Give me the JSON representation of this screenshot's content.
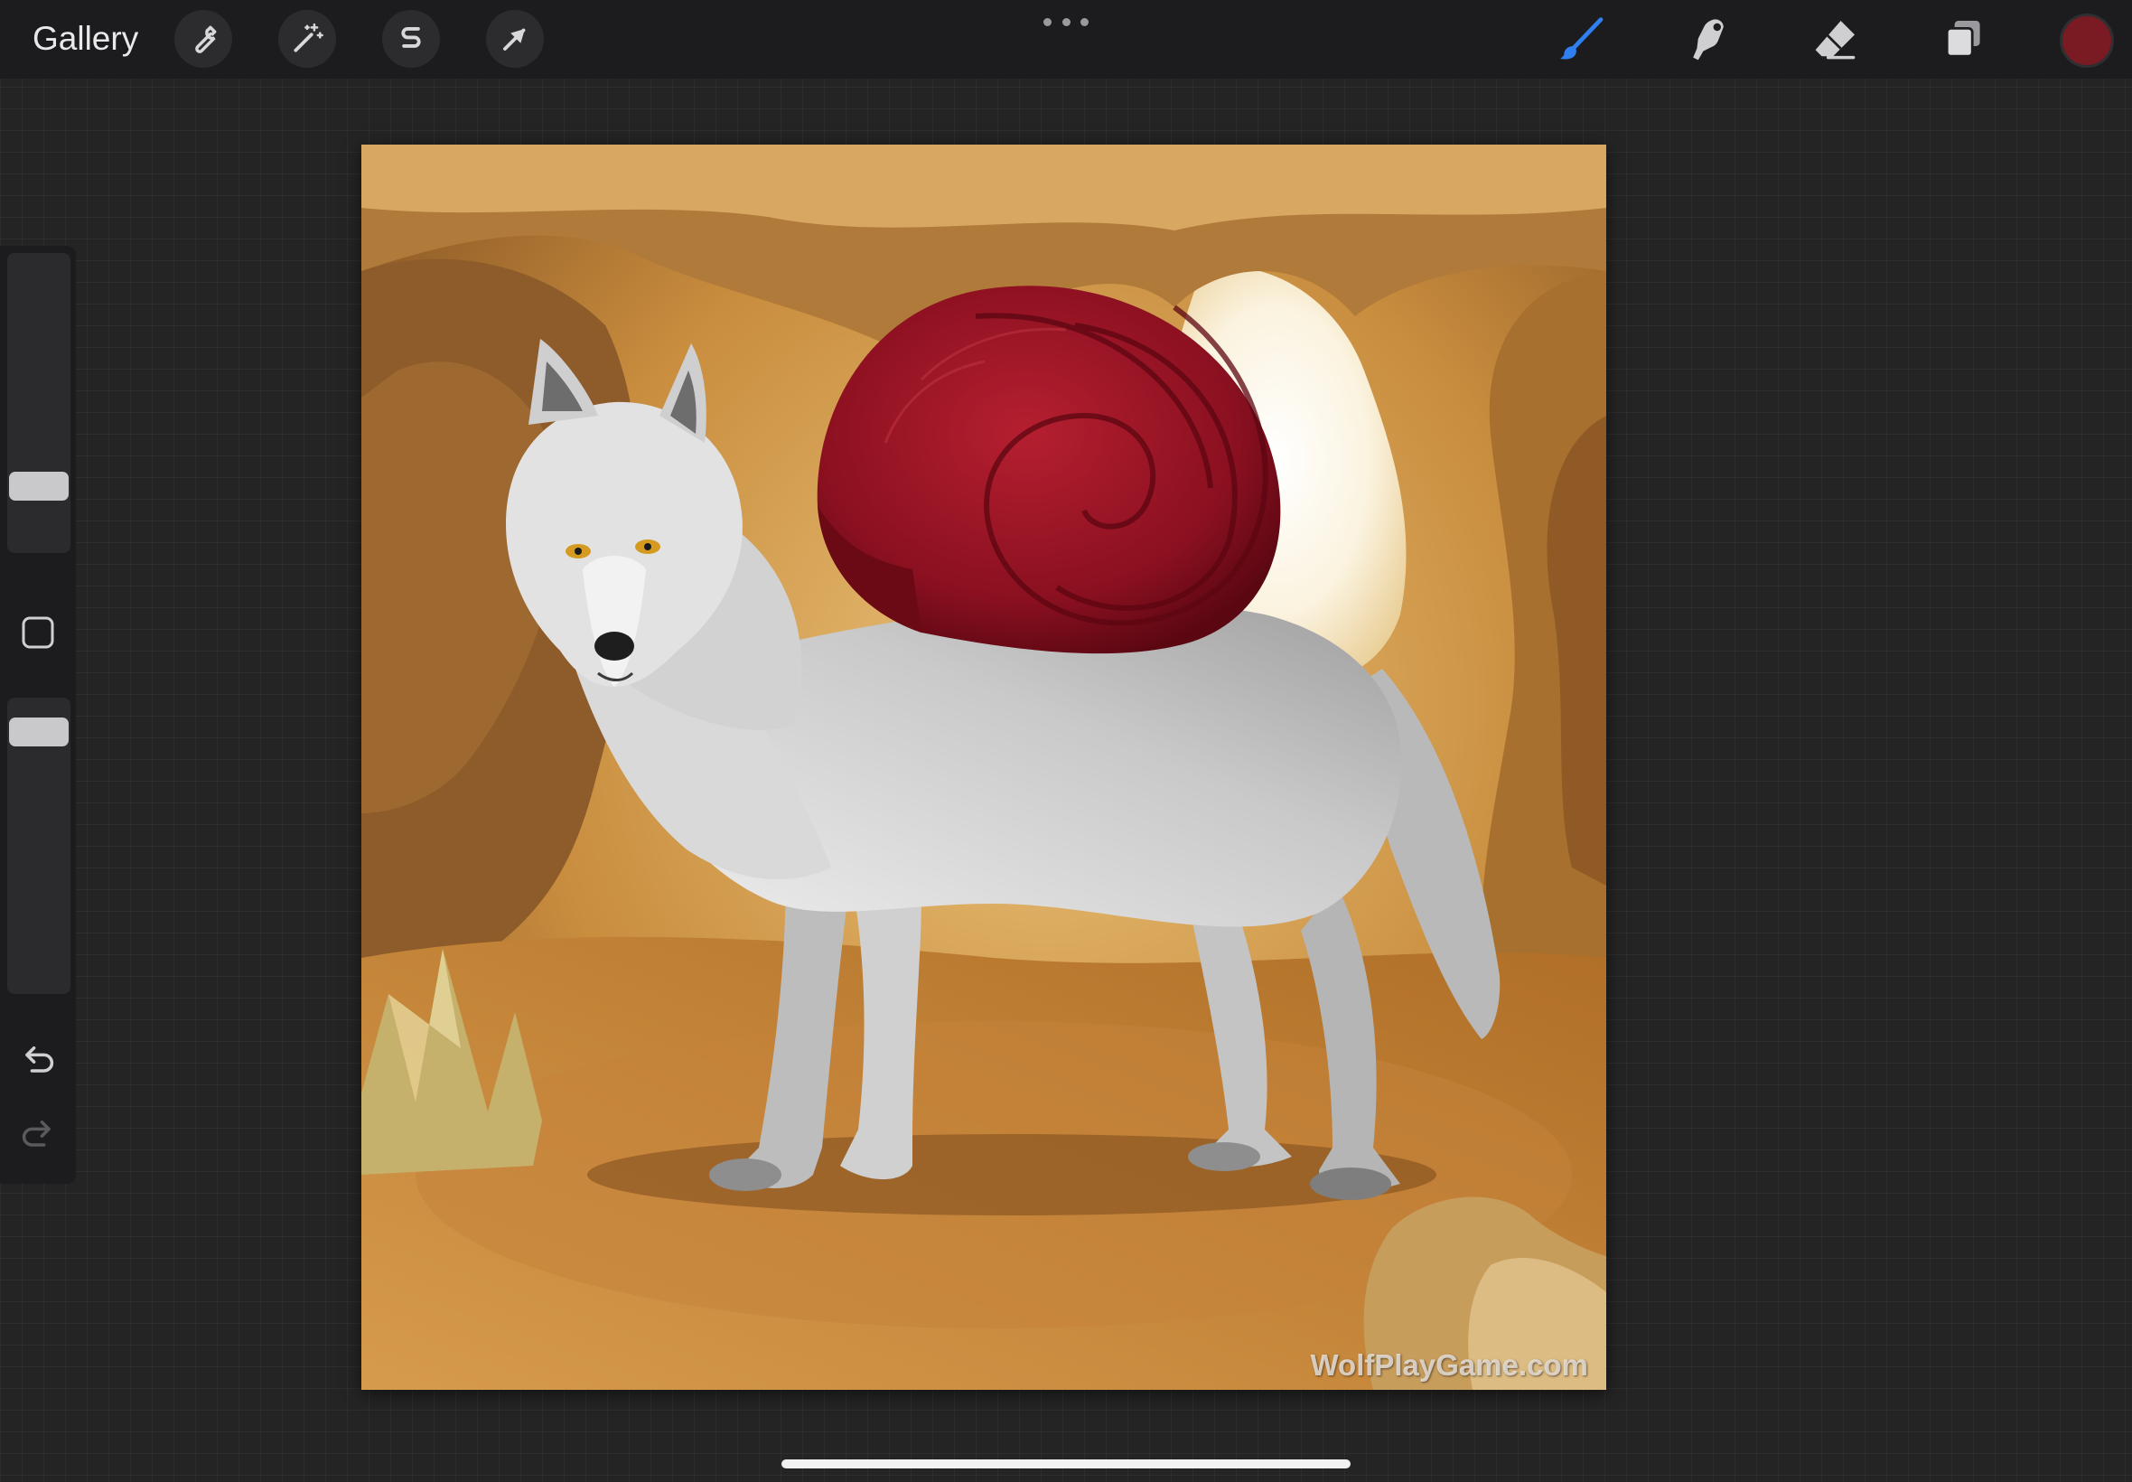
{
  "toolbar": {
    "gallery_label": "Gallery",
    "left_tools": [
      {
        "name": "actions",
        "icon": "wrench-icon"
      },
      {
        "name": "adjustments",
        "icon": "magic-wand-icon"
      },
      {
        "name": "selection",
        "icon": "selection-s-icon"
      },
      {
        "name": "transform",
        "icon": "arrow-cursor-icon"
      }
    ],
    "more_icon": "ellipsis-icon",
    "right_tools": [
      {
        "name": "brush",
        "icon": "brush-icon",
        "active": true
      },
      {
        "name": "smudge",
        "icon": "smudge-finger-icon",
        "active": false
      },
      {
        "name": "eraser",
        "icon": "eraser-icon",
        "active": false
      },
      {
        "name": "layers",
        "icon": "layers-icon",
        "active": false
      }
    ],
    "active_color": "#7a1a22",
    "accent_color": "#2f7ff0"
  },
  "sidebar": {
    "brush_size_level": 0.19,
    "opacity_level": 0.93,
    "modify_icon": "square-modify-icon",
    "undo_icon": "undo-icon",
    "redo_icon": "redo-icon",
    "redo_enabled": false
  },
  "canvas": {
    "subject": "artwork-wolf-with-snail-shell",
    "watermark_text": "WolfPlayGame.com"
  }
}
